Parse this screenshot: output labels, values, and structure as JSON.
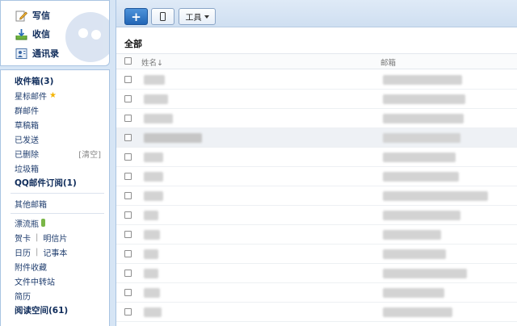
{
  "sidebar": {
    "top_links": [
      {
        "label": "写信",
        "icon": "pencil-icon"
      },
      {
        "label": "收信",
        "icon": "inbox-download-icon"
      },
      {
        "label": "通讯录",
        "icon": "contacts-icon"
      }
    ],
    "folders": [
      {
        "label": "收件箱(3)",
        "bold": true
      },
      {
        "label": "星标邮件",
        "star": true
      },
      {
        "label": "群邮件"
      },
      {
        "label": "草稿箱"
      },
      {
        "label": "已发送"
      },
      {
        "label": "已删除",
        "action": "[清空]"
      },
      {
        "label": "垃圾箱"
      },
      {
        "label": "QQ邮件订阅(1)",
        "bold": true
      }
    ],
    "other_mailbox": "其他邮箱",
    "apps": {
      "drift_bottle": "漂流瓶",
      "greeting_card": "贺卡",
      "postcard": "明信片",
      "calendar": "日历",
      "notebook": "记事本",
      "attachment_collection": "附件收藏",
      "file_transfer": "文件中转站",
      "resume": "简历",
      "reading_space": "阅读空间(61)"
    }
  },
  "toolbar": {
    "add_label": "+",
    "phone_icon": "mobile-phone-icon",
    "tools_label": "工具"
  },
  "list": {
    "title": "全部",
    "col_name": "姓名↓",
    "col_email": "邮箱"
  },
  "colors": {
    "accent": "#2266b6",
    "sidebar_text": "#1f3d6e",
    "background": "#d6e5f5"
  }
}
